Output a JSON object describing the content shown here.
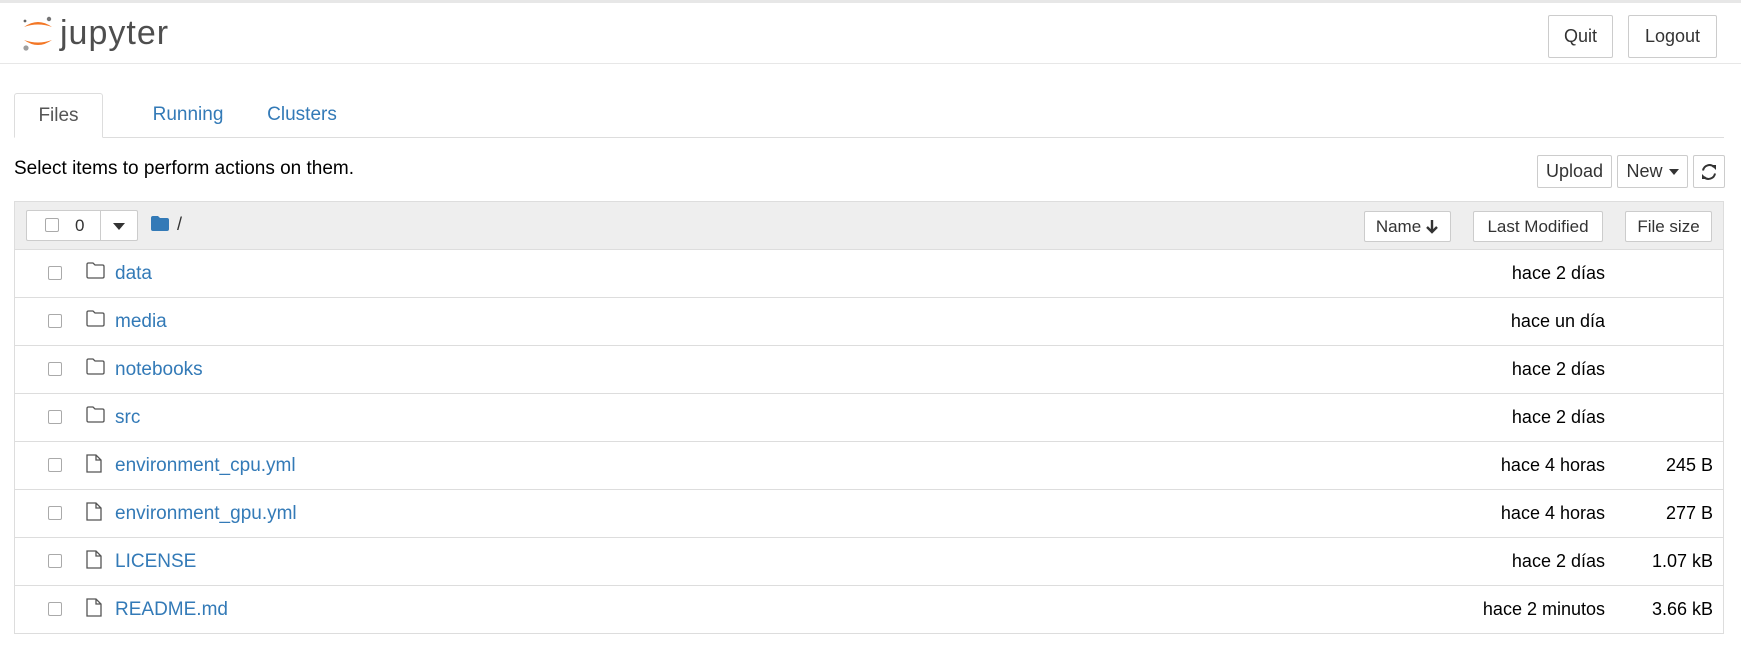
{
  "header": {
    "logo_text": "jupyter",
    "quit_label": "Quit",
    "logout_label": "Logout"
  },
  "tabs": [
    {
      "label": "Files",
      "active": true
    },
    {
      "label": "Running",
      "active": false
    },
    {
      "label": "Clusters",
      "active": false
    }
  ],
  "toolbar": {
    "hint": "Select items to perform actions on them.",
    "upload_label": "Upload",
    "new_label": "New",
    "refresh_icon": "refresh-icon"
  },
  "list_header": {
    "selected_count": "0",
    "breadcrumb": "/",
    "sort_name_label": "Name",
    "sort_modified_label": "Last Modified",
    "sort_size_label": "File size"
  },
  "items": [
    {
      "name": "data",
      "type": "folder",
      "modified": "hace 2 días",
      "size": ""
    },
    {
      "name": "media",
      "type": "folder",
      "modified": "hace un día",
      "size": ""
    },
    {
      "name": "notebooks",
      "type": "folder",
      "modified": "hace 2 días",
      "size": ""
    },
    {
      "name": "src",
      "type": "folder",
      "modified": "hace 2 días",
      "size": ""
    },
    {
      "name": "environment_cpu.yml",
      "type": "file",
      "modified": "hace 4 horas",
      "size": "245 B"
    },
    {
      "name": "environment_gpu.yml",
      "type": "file",
      "modified": "hace 4 horas",
      "size": "277 B"
    },
    {
      "name": "LICENSE",
      "type": "file",
      "modified": "hace 2 días",
      "size": "1.07 kB"
    },
    {
      "name": "README.md",
      "type": "file",
      "modified": "hace 2 minutos",
      "size": "3.66 kB"
    }
  ],
  "colors": {
    "link": "#337ab7",
    "logo_orange": "#f37726",
    "header_bg": "#eeeeee"
  }
}
